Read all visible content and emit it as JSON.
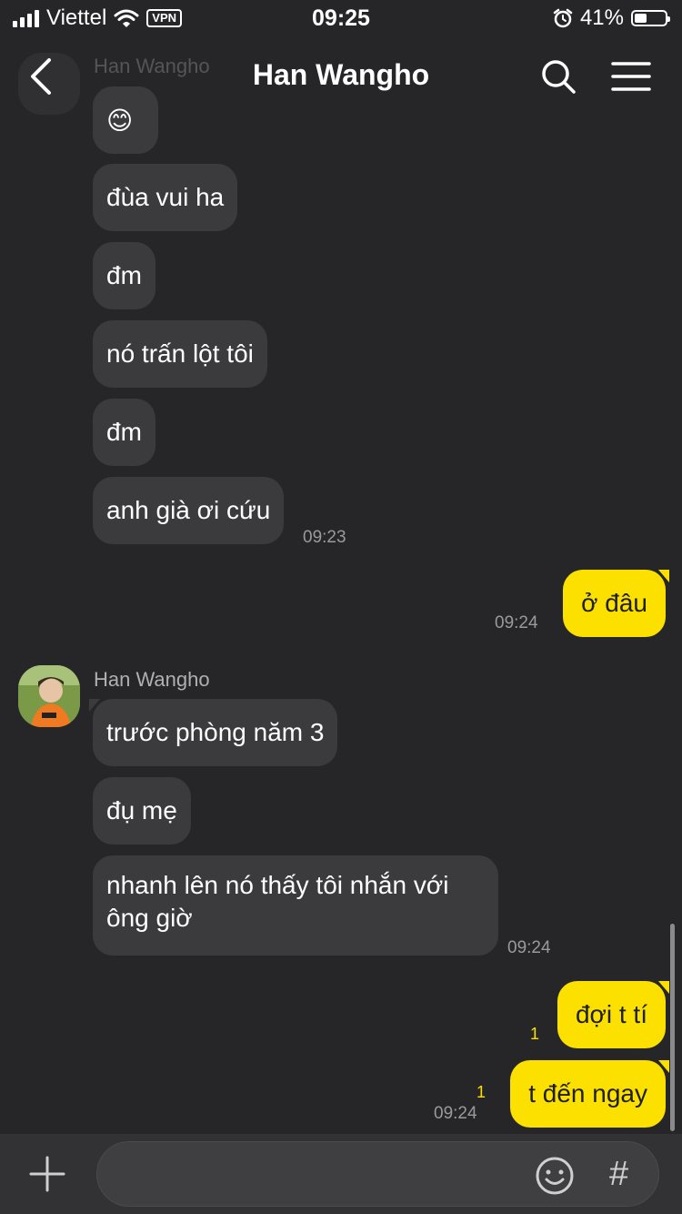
{
  "status_bar": {
    "carrier": "Viettel",
    "vpn": "VPN",
    "time": "09:25",
    "battery_percent": "41%",
    "battery_level": 0.41
  },
  "header": {
    "title": "Han Wangho",
    "ghost_sender": "Han Wangho"
  },
  "messages": {
    "emoji": "😊",
    "m1": "đùa vui ha",
    "m2": "đm",
    "m3": "nó trấn lột tôi",
    "m4": "đm",
    "m5": "anh già ơi cứu",
    "m5_time": "09:23",
    "me1": "ở đâu",
    "me1_time": "09:24",
    "sender": "Han Wangho",
    "m6": "trước phòng năm 3",
    "m7": "đụ mẹ",
    "m8": "nhanh lên nó thấy tôi nhắn với ông giờ",
    "m8_time": "09:24",
    "me2": "đợi t tí",
    "me2_unread": "1",
    "me3": "t đến ngay",
    "me3_unread": "1",
    "me3_time": "09:24"
  },
  "composer": {
    "hash": "#"
  },
  "colors": {
    "background": "#262629",
    "bubble_theirs": "#3b3b3e",
    "bubble_mine": "#fbe000",
    "unread": "#fbe000"
  }
}
